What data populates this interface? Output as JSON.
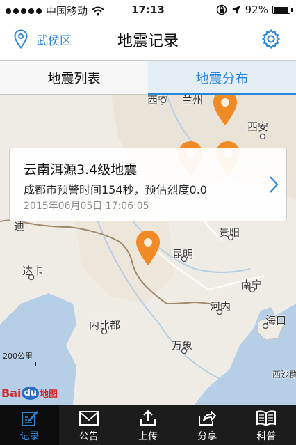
{
  "status_bar": {
    "carrier": "中国移动",
    "time": "17:13",
    "battery": "92%",
    "battery_level": 0.92
  },
  "nav": {
    "location": "武侯区",
    "title": "地震记录"
  },
  "tabs": [
    {
      "label": "地震列表",
      "active": false
    },
    {
      "label": "地震分布",
      "active": true
    }
  ],
  "map": {
    "cities": [
      "西宁",
      "兰州",
      "西安",
      "贵阳",
      "昆明",
      "南宁",
      "河内",
      "海口",
      "内比都",
      "万象",
      "达卡",
      "西沙群",
      "迪"
    ],
    "scale_label": "200公里",
    "logo": {
      "bai": "Bai",
      "du": "du",
      "tu": "地图"
    },
    "marker_color": "#f08a24"
  },
  "card": {
    "title": "云南洱源3.4级地震",
    "detail": "成都市预警时间154秒，预估烈度0.0",
    "time": "2015年06月05日 17:06:05"
  },
  "tabbar": [
    {
      "label": "记录",
      "icon": "edit-icon",
      "active": true
    },
    {
      "label": "公告",
      "icon": "mail-icon",
      "active": false
    },
    {
      "label": "上传",
      "icon": "upload-icon",
      "active": false
    },
    {
      "label": "分享",
      "icon": "share-icon",
      "active": false
    },
    {
      "label": "科普",
      "icon": "book-icon",
      "active": false
    }
  ],
  "colors": {
    "accent": "#2a86d6",
    "tabbar_bg": "#1c1c1c"
  }
}
